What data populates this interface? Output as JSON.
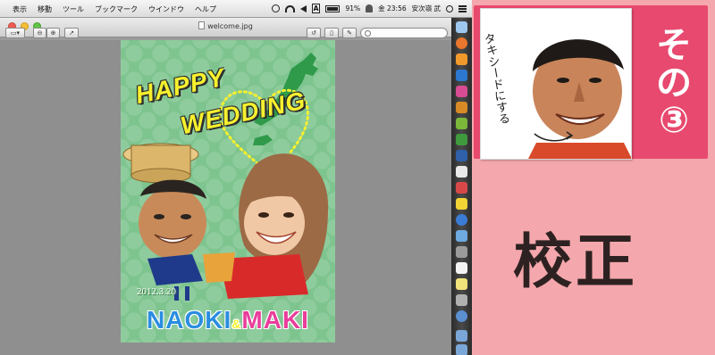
{
  "menubar": {
    "menus": [
      "表示",
      "移動",
      "ツール",
      "ブックマーク",
      "ウインドウ",
      "ヘルプ"
    ],
    "battery": "91%",
    "clock": "金 23:56",
    "user": "安次嶺 武"
  },
  "window": {
    "title": "welcome.jpg"
  },
  "card": {
    "title_line1": "HAPPY",
    "title_line2": "WEDDING",
    "date": "2012.3.20",
    "name1": "NAOKI",
    "amp": "&",
    "name2": "MAKI"
  },
  "badge": {
    "episode": "その③",
    "caption": "タキシードにする"
  },
  "heading": "校正",
  "colors": {
    "background_pink": "#f4a7ac",
    "badge_pink": "#e8496f",
    "card_green": "#7ec48f",
    "title_yellow": "#f6f02e",
    "name_blue": "#2a8de0",
    "name_magenta": "#e93d9b"
  }
}
